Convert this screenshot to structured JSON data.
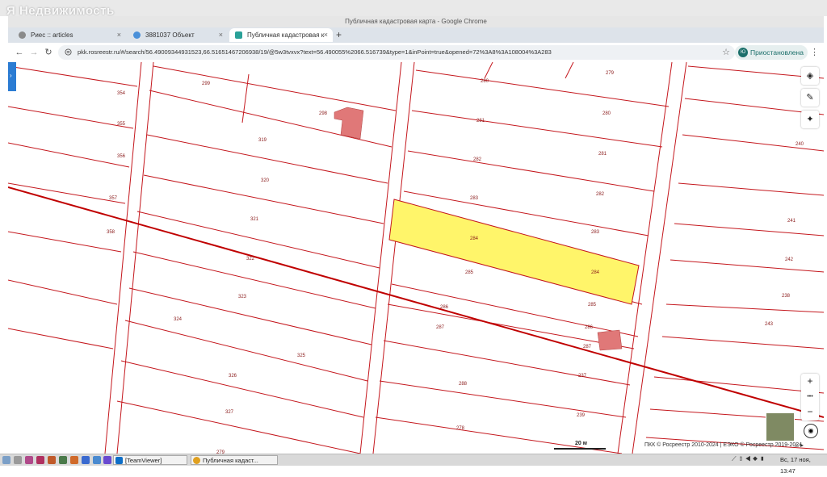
{
  "watermark": "Недвижимость",
  "window": {
    "title": "Публичная кадастровая карта - Google Chrome"
  },
  "tabs": [
    {
      "label": "Риес :: articles",
      "icon": "globe-icon",
      "active": false
    },
    {
      "label": "3881037 Объект",
      "icon": "globe-icon",
      "active": false
    },
    {
      "label": "Публичная кадастровая к",
      "icon": "map-icon",
      "active": true
    }
  ],
  "new_tab": "+",
  "toolbar": {
    "url": "pkk.rosreestr.ru/#/search/56.49009344931523,66.51651467206938/19/@5w3tvxvx?text=56.490055%2066.516739&type=1&inPoint=true&opened=72%3A8%3A108004%3A283",
    "profile_initial": "Ю",
    "profile_label": "Приостановлена"
  },
  "map": {
    "colors": {
      "boundary": "#c4171d",
      "road": "#c00000",
      "selected_fill": "#fff56a",
      "building": "#e07878"
    },
    "labels": [
      "354",
      "355",
      "356",
      "357",
      "358",
      "299",
      "298",
      "319",
      "320",
      "321",
      "322",
      "323",
      "324",
      "325",
      "326",
      "327",
      "279",
      "280",
      "281",
      "282",
      "283",
      "284",
      "285",
      "286",
      "287",
      "288",
      "278",
      "279",
      "280",
      "281",
      "282",
      "283",
      "284",
      "285",
      "286",
      "287",
      "237",
      "239",
      "240",
      "241",
      "242",
      "238",
      "243"
    ],
    "scale_label": "20 м",
    "copyright": "ПКК © Росреестр 2010-2024 | ЕЭКО © Росреестр 2019-2024"
  },
  "map_tools": {
    "zoom_in": "+",
    "more": "•••",
    "zoom_out": "−"
  },
  "taskbar": {
    "apps": [
      {
        "label": "[TeamViewer]"
      },
      {
        "label": "Публичная кадаст..."
      }
    ],
    "clock": "Вс, 17 ноя, 13:47"
  }
}
